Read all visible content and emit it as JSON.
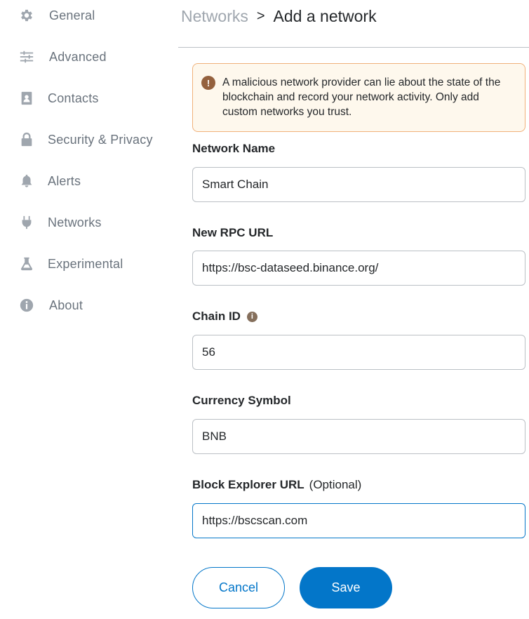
{
  "sidebar": {
    "items": [
      {
        "label": "General",
        "icon": "gear-icon"
      },
      {
        "label": "Advanced",
        "icon": "sliders-icon"
      },
      {
        "label": "Contacts",
        "icon": "contacts-icon"
      },
      {
        "label": "Security & Privacy",
        "icon": "lock-icon"
      },
      {
        "label": "Alerts",
        "icon": "bell-icon"
      },
      {
        "label": "Networks",
        "icon": "plug-icon"
      },
      {
        "label": "Experimental",
        "icon": "flask-icon"
      },
      {
        "label": "About",
        "icon": "info-icon"
      }
    ]
  },
  "header": {
    "parent": "Networks",
    "separator": ">",
    "title": "Add a network"
  },
  "warning": {
    "icon": "warning-icon",
    "text": "A malicious network provider can lie about the state of the blockchain and record your network activity. Only add custom networks you trust."
  },
  "form": {
    "network_name": {
      "label": "Network Name",
      "value": "Smart Chain"
    },
    "rpc_url": {
      "label": "New RPC URL",
      "value": "https://bsc-dataseed.binance.org/"
    },
    "chain_id": {
      "label": "Chain ID",
      "value": "56"
    },
    "currency_symbol": {
      "label": "Currency Symbol",
      "value": "BNB"
    },
    "block_explorer": {
      "label": "Block Explorer URL",
      "optional": "(Optional)",
      "value": "https://bscscan.com"
    }
  },
  "buttons": {
    "cancel": "Cancel",
    "save": "Save"
  },
  "colors": {
    "primary": "#0376c9",
    "warning_border": "#f0b17a",
    "warning_bg": "#fef8ed"
  }
}
